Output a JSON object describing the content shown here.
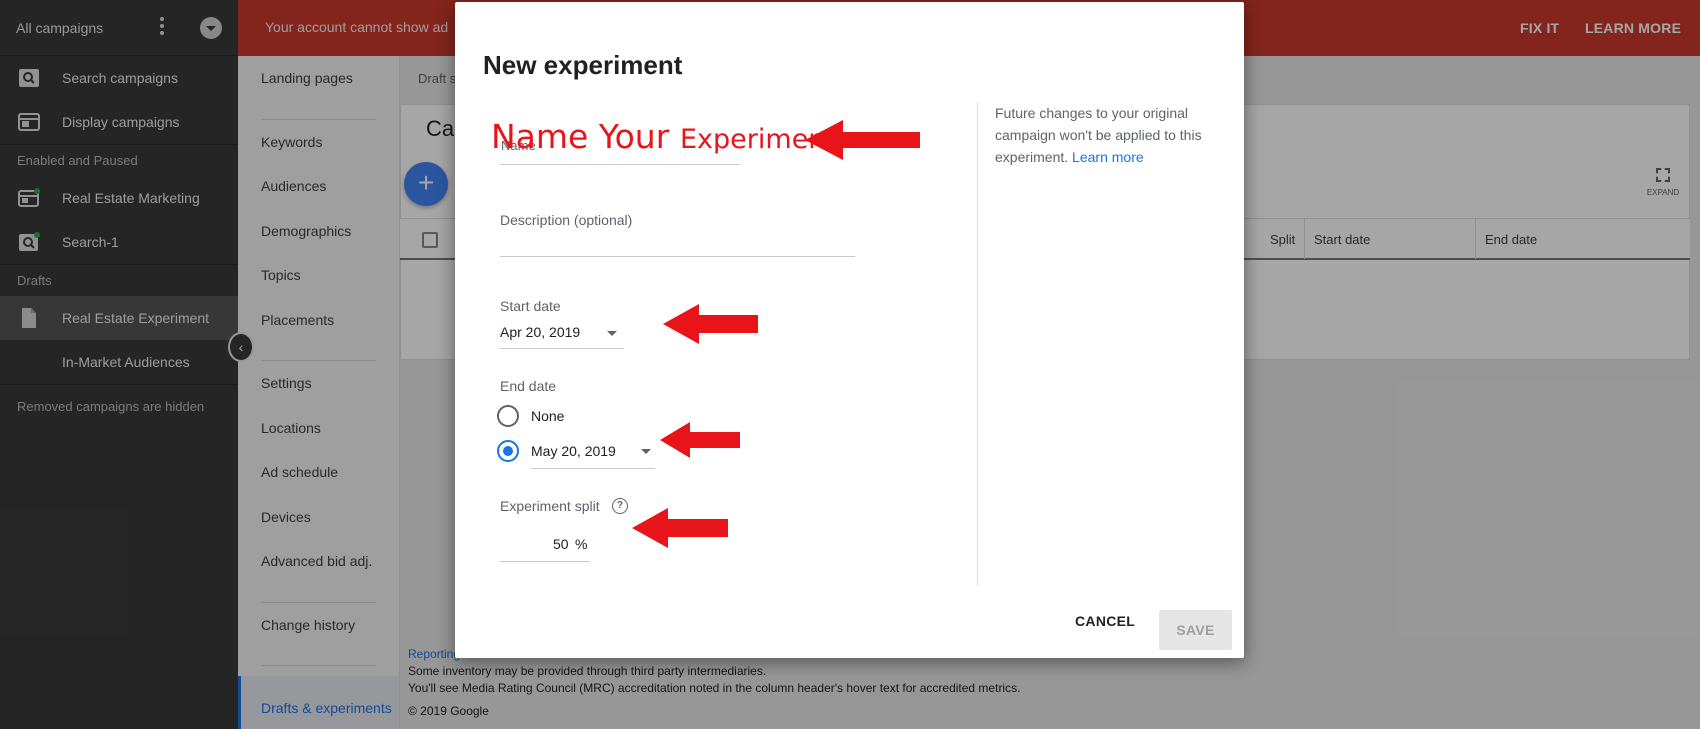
{
  "sidebar": {
    "header_label": "All campaigns",
    "items": [
      {
        "label": "Search campaigns"
      },
      {
        "label": "Display campaigns"
      }
    ],
    "section_enabled": "Enabled and Paused",
    "enabled_items": [
      {
        "label": "Real Estate Marketing"
      },
      {
        "label": "Search-1"
      }
    ],
    "section_drafts": "Drafts",
    "draft_items": [
      {
        "label": "Real Estate Experiment"
      },
      {
        "label": "In-Market Audiences"
      }
    ],
    "hidden_note": "Removed campaigns are hidden"
  },
  "banner": {
    "message": "Your account cannot show ad",
    "fix_it": "FIX IT",
    "learn_more": "LEARN MORE",
    "color": "#c9392c"
  },
  "subnav": {
    "items": [
      "Landing pages",
      "Keywords",
      "Audiences",
      "Demographics",
      "Topics",
      "Placements",
      "Settings",
      "Locations",
      "Ad schedule",
      "Devices",
      "Advanced bid adj.",
      "Change history"
    ],
    "active": "Drafts & experiments"
  },
  "main": {
    "breadcrumb": "Draft s",
    "card_title": "Car",
    "expand_label": "EXPAND",
    "columns": [
      "Split",
      "Start date",
      "End date"
    ],
    "footer": {
      "line1": "Reporting",
      "line2": "Some inventory may be provided through third party intermediaries.",
      "line3": "You'll see Media Rating Council (MRC) accreditation noted in the column header's hover text for accredited metrics.",
      "line4": "© 2019 Google"
    }
  },
  "modal": {
    "title": "New experiment",
    "name_label": "Name",
    "description_label": "Description (optional)",
    "start_date_label": "Start date",
    "start_date_value": "Apr 20, 2019",
    "end_date_label": "End date",
    "end_none_label": "None",
    "end_date_value": "May 20, 2019",
    "split_label": "Experiment split",
    "split_value": "50",
    "split_unit": "%",
    "side_text": "Future changes to your original campaign won't be applied to this experiment.",
    "side_link": "Learn more",
    "cancel": "CANCEL",
    "save": "SAVE"
  },
  "annotation": {
    "text_big": "Name Your",
    "text_small": "Experiment",
    "color": "#e8141a"
  }
}
